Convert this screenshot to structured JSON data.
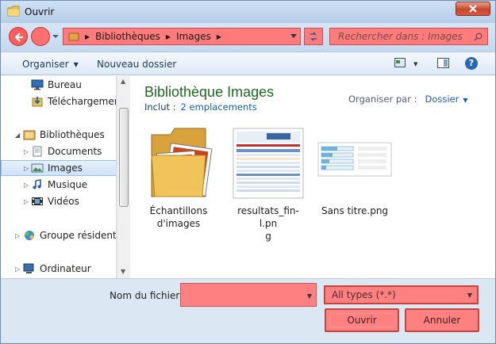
{
  "window": {
    "title": "Ouvrir"
  },
  "address": {
    "breadcrumb": [
      "Bibliothèques",
      "Images"
    ],
    "search_placeholder": "Rechercher dans : Images"
  },
  "toolbar": {
    "organise_label": "Organiser",
    "new_folder_label": "Nouveau dossier"
  },
  "sidebar": {
    "items": [
      {
        "label": "Bureau",
        "icon": "desktop-icon"
      },
      {
        "label": "Téléchargements",
        "icon": "downloads-icon"
      },
      {
        "label": "Bibliothèques",
        "icon": "libraries-icon"
      },
      {
        "label": "Documents",
        "icon": "documents-icon"
      },
      {
        "label": "Images",
        "icon": "pictures-icon",
        "selected": true
      },
      {
        "label": "Musique",
        "icon": "music-icon"
      },
      {
        "label": "Vidéos",
        "icon": "videos-icon"
      },
      {
        "label": "Groupe résidentiel",
        "icon": "homegroup-icon"
      },
      {
        "label": "Ordinateur",
        "icon": "computer-icon"
      }
    ]
  },
  "content": {
    "title": "Bibliothèque Images",
    "includes_label": "Inclut :",
    "includes_link": "2 emplacements",
    "arrange_label": "Organiser par :",
    "arrange_value": "Dossier",
    "files": [
      {
        "name_line1": "Échantillons",
        "name_line2": "d'images",
        "icon": "folder-icon"
      },
      {
        "name_line1": "resultats_fin-l.pn",
        "name_line2": "g",
        "icon": "image-thumbnail"
      },
      {
        "name_line1": "Sans titre.png",
        "name_line2": "",
        "icon": "image-thumbnail"
      }
    ]
  },
  "bottom": {
    "filename_label": "Nom du fichier :",
    "filename_value": "",
    "filetype_value": "All types (*.*)",
    "open_label": "Ouvrir",
    "cancel_label": "Annuler"
  }
}
